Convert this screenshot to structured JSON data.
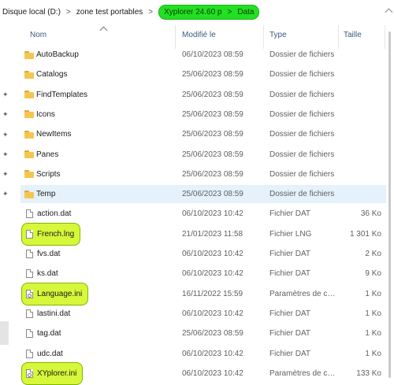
{
  "breadcrumb": {
    "items": [
      "Disque local (D:)",
      "zone test portables"
    ],
    "highlighted": [
      "Xyplorer 24.60 p",
      "Data"
    ],
    "separator": ">"
  },
  "columns": {
    "name": "Nom",
    "modified": "Modifié le",
    "type": "Type",
    "size": "Taille"
  },
  "files": [
    {
      "name": "AutoBackup",
      "icon": "folder-icon",
      "modified": "06/10/2023 08:59",
      "type": "Dossier de fichiers",
      "size": "",
      "highlight": false,
      "selected": false
    },
    {
      "name": "Catalogs",
      "icon": "folder-icon",
      "modified": "25/06/2023 08:59",
      "type": "Dossier de fichiers",
      "size": "",
      "highlight": false,
      "selected": false
    },
    {
      "name": "FindTemplates",
      "icon": "folder-icon",
      "modified": "25/06/2023 08:59",
      "type": "Dossier de fichiers",
      "size": "",
      "highlight": false,
      "selected": false
    },
    {
      "name": "Icons",
      "icon": "folder-icon",
      "modified": "25/06/2023 08:59",
      "type": "Dossier de fichiers",
      "size": "",
      "highlight": false,
      "selected": false
    },
    {
      "name": "NewItems",
      "icon": "folder-icon",
      "modified": "25/06/2023 08:59",
      "type": "Dossier de fichiers",
      "size": "",
      "highlight": false,
      "selected": false
    },
    {
      "name": "Panes",
      "icon": "folder-icon",
      "modified": "25/06/2023 08:59",
      "type": "Dossier de fichiers",
      "size": "",
      "highlight": false,
      "selected": false
    },
    {
      "name": "Scripts",
      "icon": "folder-icon",
      "modified": "25/06/2023 08:59",
      "type": "Dossier de fichiers",
      "size": "",
      "highlight": false,
      "selected": false
    },
    {
      "name": "Temp",
      "icon": "folder-icon",
      "modified": "25/06/2023 08:59",
      "type": "Dossier de fichiers",
      "size": "",
      "highlight": false,
      "selected": true
    },
    {
      "name": "action.dat",
      "icon": "file-icon",
      "modified": "06/10/2023 10:42",
      "type": "Fichier DAT",
      "size": "36 Ko",
      "highlight": false,
      "selected": false
    },
    {
      "name": "French.lng",
      "icon": "file-icon",
      "modified": "21/01/2023 11:58",
      "type": "Fichier LNG",
      "size": "1 301 Ko",
      "highlight": true,
      "selected": false
    },
    {
      "name": "fvs.dat",
      "icon": "file-icon",
      "modified": "06/10/2023 10:42",
      "type": "Fichier DAT",
      "size": "2 Ko",
      "highlight": false,
      "selected": false
    },
    {
      "name": "ks.dat",
      "icon": "file-icon",
      "modified": "06/10/2023 10:42",
      "type": "Fichier DAT",
      "size": "9 Ko",
      "highlight": false,
      "selected": false
    },
    {
      "name": "Language.ini",
      "icon": "settings-file-icon",
      "modified": "16/11/2022 15:59",
      "type": "Paramètres de con...",
      "size": "1 Ko",
      "highlight": true,
      "selected": false
    },
    {
      "name": "lastini.dat",
      "icon": "file-icon",
      "modified": "06/10/2023 10:42",
      "type": "Fichier DAT",
      "size": "1 Ko",
      "highlight": false,
      "selected": false
    },
    {
      "name": "tag.dat",
      "icon": "file-icon",
      "modified": "25/06/2023 08:59",
      "type": "Fichier DAT",
      "size": "1 Ko",
      "highlight": false,
      "selected": false
    },
    {
      "name": "udc.dat",
      "icon": "file-icon",
      "modified": "06/10/2023 10:42",
      "type": "Fichier DAT",
      "size": "1 Ko",
      "highlight": false,
      "selected": false
    },
    {
      "name": "XYplorer.ini",
      "icon": "settings-file-icon",
      "modified": "06/10/2023 10:42",
      "type": "Paramètres de con...",
      "size": "133 Ko",
      "highlight": true,
      "selected": false
    }
  ],
  "colors": {
    "breadcrumb_highlight": "#22e022",
    "file_highlight": "#d6f73a",
    "selection": "#e5f1fb"
  }
}
